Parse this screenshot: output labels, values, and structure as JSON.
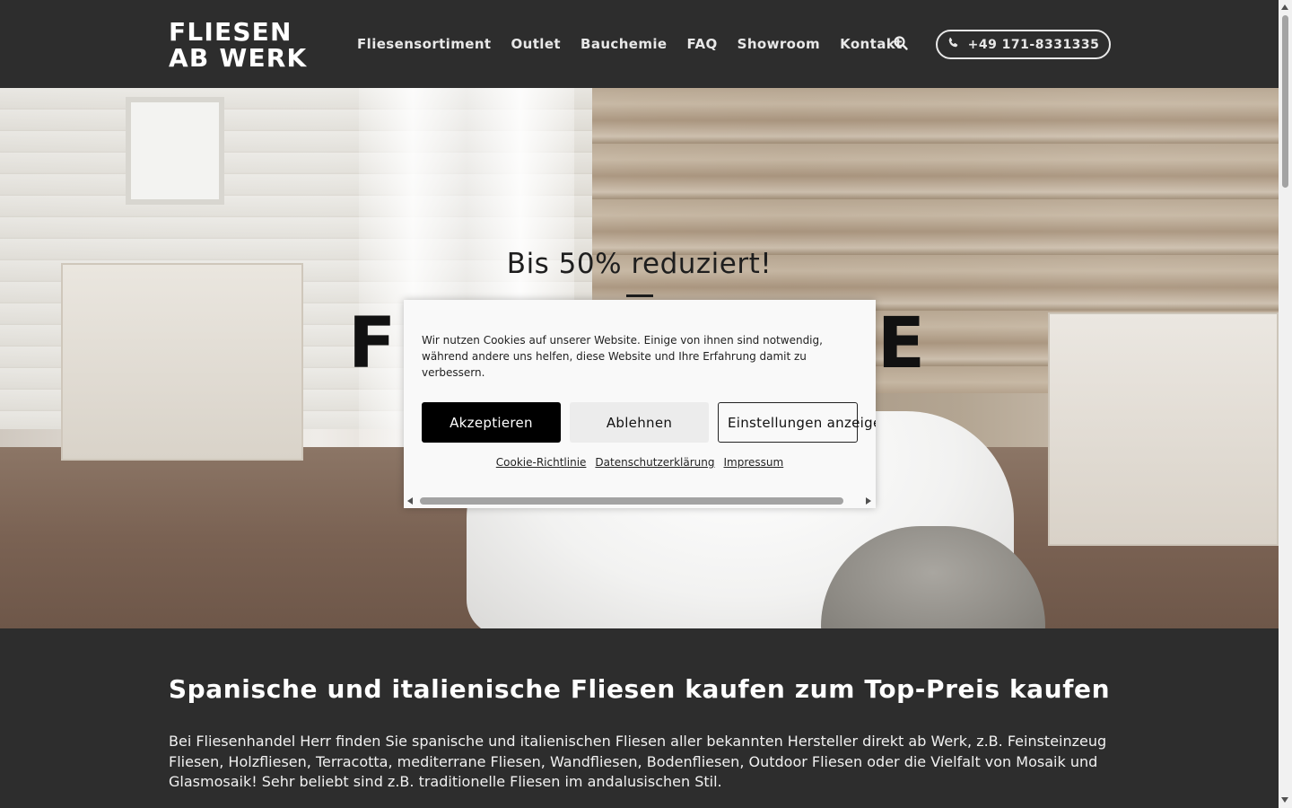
{
  "header": {
    "logo_line1": "FLIESEN",
    "logo_line2": "AB WERK",
    "nav": [
      "Fliesensortiment",
      "Outlet",
      "Bauchemie",
      "FAQ",
      "Showroom",
      "Kontakt"
    ],
    "phone": "+49 171-8331335"
  },
  "hero": {
    "subtitle": "Bis 50% reduziert!",
    "headline": "F                E"
  },
  "cookie": {
    "text": "Wir nutzen Cookies auf unserer Website. Einige von ihnen sind notwendig, während andere uns helfen, diese Website und Ihre Erfahrung damit zu verbessern.",
    "accept": "Akzeptieren",
    "decline": "Ablehnen",
    "settings": "Einstellungen anzeigen",
    "links": [
      "Cookie-Richtlinie",
      "Datenschutzerklärung",
      "Impressum"
    ]
  },
  "section": {
    "title": "Spanische und italienische Fliesen kaufen zum Top-Preis kaufen",
    "text": "Bei Fliesenhandel Herr finden Sie spanische und italienischen Fliesen aller bekannten Hersteller direkt ab Werk, z.B. Feinsteinzeug Fliesen, Holzfliesen, Terracotta, mediterrane Fliesen, Wandfliesen, Bodenfliesen, Outdoor Fliesen oder die Vielfalt von Mosaik und Glasmosaik! Sehr beliebt sind z.B. traditionelle Fliesen im andalusischen Stil."
  },
  "colors": {
    "header_bg": "#2d2d2d",
    "accept_bg": "#000000",
    "decline_bg": "#ececec"
  },
  "icons": {
    "search": "search-icon",
    "phone": "phone-icon"
  }
}
